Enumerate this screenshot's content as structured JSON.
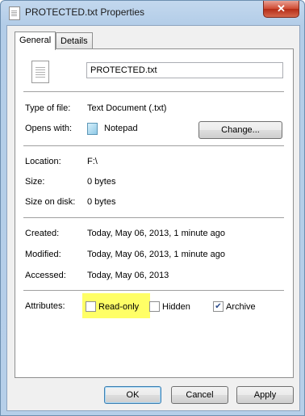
{
  "window": {
    "title": "PROTECTED.txt Properties",
    "close_label": "✕"
  },
  "tabs": [
    {
      "label": "General"
    },
    {
      "label": "Details"
    }
  ],
  "general": {
    "file_name": "PROTECTED.txt",
    "type_label": "Type of file:",
    "type_value": "Text Document (.txt)",
    "opens_label": "Opens with:",
    "opens_value": "Notepad",
    "change_label": "Change...",
    "location_label": "Location:",
    "location_value": "F:\\",
    "size_label": "Size:",
    "size_value": "0 bytes",
    "size_disk_label": "Size on disk:",
    "size_disk_value": "0 bytes",
    "created_label": "Created:",
    "created_value": "Today, May 06, 2013, 1 minute ago",
    "modified_label": "Modified:",
    "modified_value": "Today, May 06, 2013, 1 minute ago",
    "accessed_label": "Accessed:",
    "accessed_value": "Today, May 06, 2013",
    "attributes_label": "Attributes:",
    "attributes": [
      {
        "label": "Read-only",
        "checked": false
      },
      {
        "label": "Hidden",
        "checked": false
      },
      {
        "label": "Archive",
        "checked": true
      }
    ]
  },
  "buttons": {
    "ok": "OK",
    "cancel": "Cancel",
    "apply": "Apply"
  },
  "colors": {
    "highlight": "#ffff66",
    "title_bar": "#b9d1ea"
  }
}
